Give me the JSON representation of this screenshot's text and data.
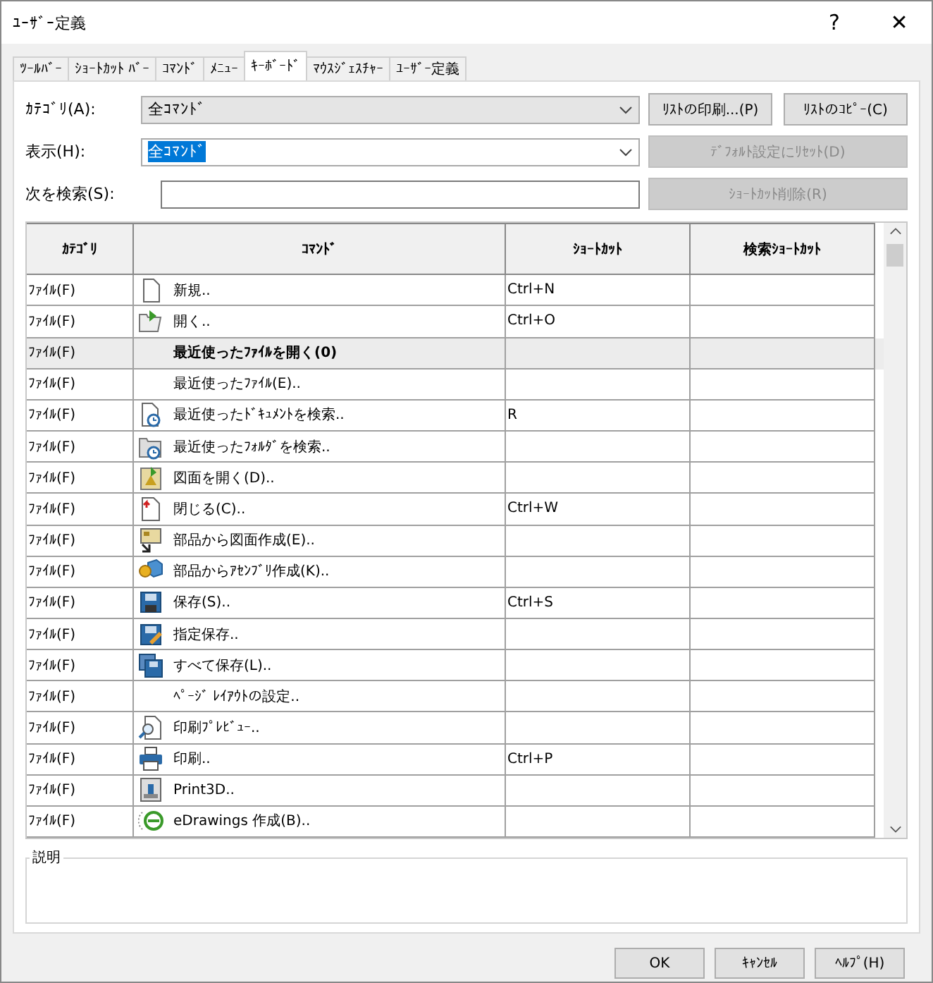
{
  "window": {
    "title": "ﾕｰｻﾞｰ定義",
    "help": "?",
    "close": "✕"
  },
  "tabs": [
    {
      "label": "ﾂｰﾙﾊﾞｰ",
      "selected": false
    },
    {
      "label": "ｼｮｰﾄｶｯﾄ ﾊﾞｰ",
      "selected": false
    },
    {
      "label": "ｺﾏﾝﾄﾞ",
      "selected": false
    },
    {
      "label": "ﾒﾆｭｰ",
      "selected": false
    },
    {
      "label": "ｷｰﾎﾞｰﾄﾞ",
      "selected": true
    },
    {
      "label": "ﾏｳｽｼﾞｪｽﾁｬｰ",
      "selected": false
    },
    {
      "label": "ﾕｰｻﾞｰ定義",
      "selected": false
    }
  ],
  "category": {
    "label": "ｶﾃｺﾞﾘ(A):",
    "value": "全ｺﾏﾝﾄﾞ"
  },
  "display": {
    "label": "表示(H):",
    "value": "全ｺﾏﾝﾄﾞ"
  },
  "search": {
    "label": "次を検索(S):"
  },
  "buttons": [
    {
      "label": "ﾘｽﾄの印刷...(P)",
      "disabled": false
    },
    {
      "label": "ﾘｽﾄのｺﾋﾟｰ(C)",
      "disabled": false
    },
    {
      "label": "ﾃﾞﾌｫﾙﾄ設定にﾘｾｯﾄ(D)",
      "disabled": true
    },
    {
      "label": "ｼｮｰﾄｶｯﾄ削除(R)",
      "disabled": true
    }
  ],
  "table": {
    "columns": [
      "ｶﾃｺﾞﾘ",
      "ｺﾏﾝﾄﾞ",
      "ｼｮｰﾄｶｯﾄ",
      "検索ｼｮｰﾄｶｯﾄ"
    ],
    "rows": [
      {
        "kind": "item",
        "category": "ﾌｧｲﾙ(F)",
        "command": "新規..",
        "shortcut": "Ctrl+N"
      },
      {
        "kind": "item",
        "category": "ﾌｧｲﾙ(F)",
        "command": "開く..",
        "shortcut": "Ctrl+O"
      },
      {
        "kind": "group",
        "category": "ﾌｧｲﾙ(F)",
        "command": "最近使ったﾌｧｲﾙを開く(0)"
      },
      {
        "kind": "item",
        "category": "ﾌｧｲﾙ(F)",
        "command": "最近使ったﾌｧｲﾙ(E).."
      },
      {
        "kind": "item",
        "category": "ﾌｧｲﾙ(F)",
        "command": "最近使ったﾄﾞｷｭﾒﾝﾄを検索..",
        "shortcut": "R"
      },
      {
        "kind": "item",
        "category": "ﾌｧｲﾙ(F)",
        "command": "最近使ったﾌｫﾙﾀﾞを検索.."
      },
      {
        "kind": "item",
        "category": "ﾌｧｲﾙ(F)",
        "command": "図面を開く(D).."
      },
      {
        "kind": "item",
        "category": "ﾌｧｲﾙ(F)",
        "command": "閉じる(C)..",
        "shortcut": "Ctrl+W"
      },
      {
        "kind": "item",
        "category": "ﾌｧｲﾙ(F)",
        "command": "部品から図面作成(E).."
      },
      {
        "kind": "item",
        "category": "ﾌｧｲﾙ(F)",
        "command": "部品からｱｾﾝﾌﾞﾘ作成(K).."
      },
      {
        "kind": "item",
        "category": "ﾌｧｲﾙ(F)",
        "command": "保存(S)..",
        "shortcut": "Ctrl+S"
      },
      {
        "kind": "item",
        "category": "ﾌｧｲﾙ(F)",
        "command": "指定保存.."
      },
      {
        "kind": "item",
        "category": "ﾌｧｲﾙ(F)",
        "command": "すべて保存(L).."
      },
      {
        "kind": "item",
        "category": "ﾌｧｲﾙ(F)",
        "command": "ﾍﾟｰｼﾞ ﾚｲｱｳﾄの設定.."
      },
      {
        "kind": "item",
        "category": "ﾌｧｲﾙ(F)",
        "command": "印刷ﾌﾟﾚﾋﾞｭｰ.."
      },
      {
        "kind": "item",
        "category": "ﾌｧｲﾙ(F)",
        "command": "印刷..",
        "shortcut": "Ctrl+P"
      },
      {
        "kind": "item",
        "category": "ﾌｧｲﾙ(F)",
        "command": "Print3D.."
      },
      {
        "kind": "item",
        "category": "ﾌｧｲﾙ(F)",
        "command": "eDrawings 作成(B).."
      }
    ]
  },
  "description": {
    "label": "説明"
  },
  "footer": [
    {
      "label": "OK"
    },
    {
      "label": "ｷｬﾝｾﾙ"
    },
    {
      "label": "ﾍﾙﾌﾟ(H)"
    }
  ]
}
